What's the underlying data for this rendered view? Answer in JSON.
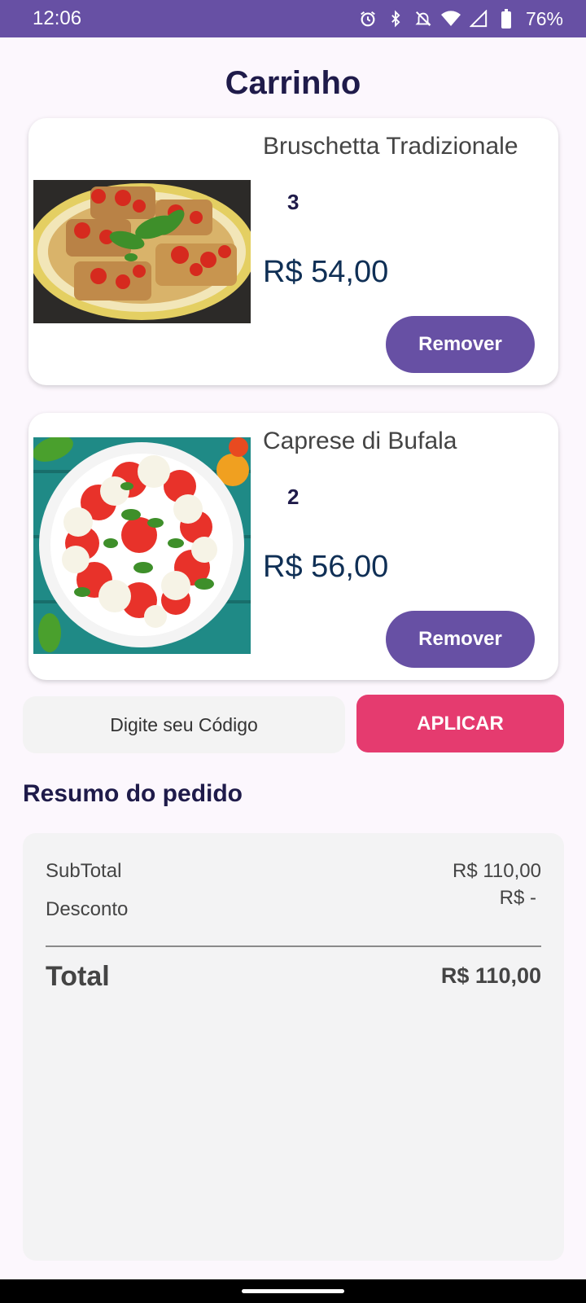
{
  "status_bar": {
    "time": "12:06",
    "battery_percent": "76%",
    "icons": [
      "alarm-icon",
      "bluetooth-icon",
      "notifications-off-icon",
      "wifi-icon",
      "cell-signal-icon",
      "battery-icon"
    ],
    "background_color": "#6750a4"
  },
  "page": {
    "title": "Carrinho"
  },
  "cart": {
    "items": [
      {
        "name": "Bruschetta Tradizionale",
        "quantity": "3",
        "price": "R$ 54,00",
        "remove_label": "Remover",
        "image": "bruschetta-photo"
      },
      {
        "name": "Caprese di Bufala",
        "quantity": "2",
        "price": "R$ 56,00",
        "remove_label": "Remover",
        "image": "caprese-photo"
      }
    ]
  },
  "coupon": {
    "placeholder": "Digite seu Código",
    "apply_label": "APLICAR"
  },
  "summary": {
    "title": "Resumo do pedido",
    "subtotal_label": "SubTotal",
    "subtotal_value": "R$ 110,00",
    "discount_label": "Desconto",
    "discount_value": "R$ -",
    "total_label": "Total",
    "total_value": "R$ 110,00"
  },
  "colors": {
    "primary": "#6750a4",
    "accent": "#e53b6f",
    "title_text": "#1f1b4a",
    "price_text": "#0f2f55",
    "background": "#fcf7fd"
  }
}
